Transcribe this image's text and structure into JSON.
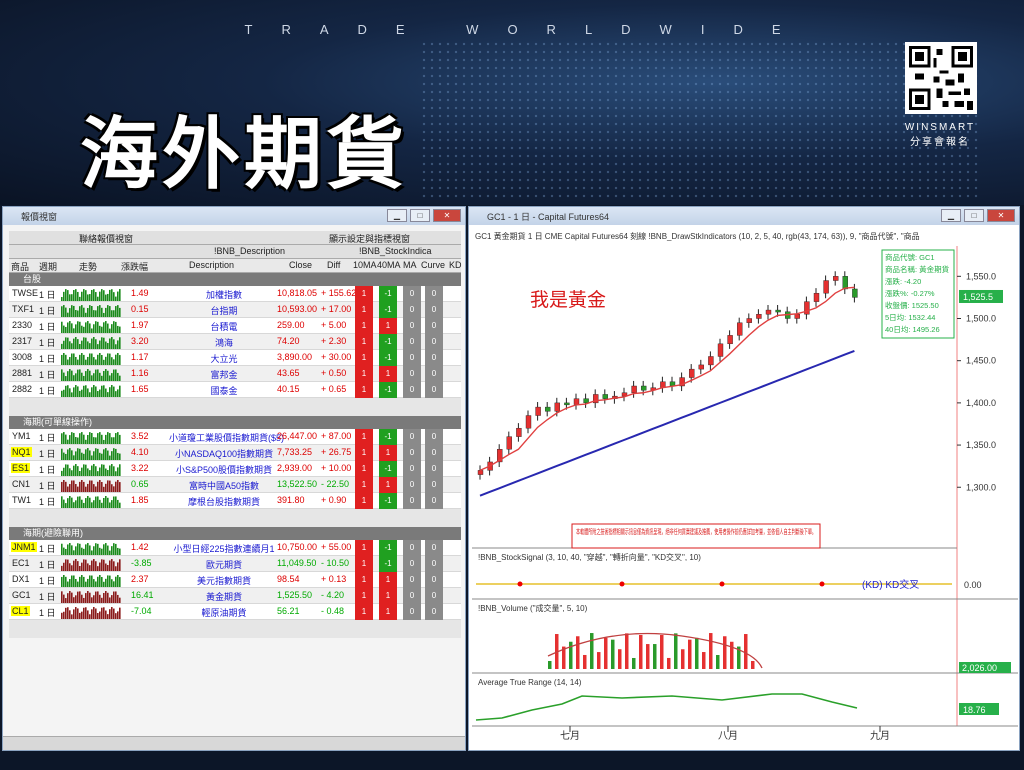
{
  "banner": {
    "tagline": "TRADE WORLDWIDE",
    "title": "海外期貨",
    "brand_line1": "WINSMART",
    "brand_line2": "分享會報名"
  },
  "left_window": {
    "title": "報價視窗",
    "col1_title": "聯絡報價視窗",
    "col2_title": "顯示設定與指標視窗",
    "desc_group": "!BNB_Description",
    "sig_group": "!BNB_StockIndica",
    "headers": {
      "symbol": "商品",
      "period": "週期",
      "trend": "走勢",
      "amp": "漲跌幅",
      "desc": "Description",
      "close": "Close",
      "diff": "Diff",
      "ma10": "10MA",
      "ma40": "40MA",
      "ma": "MA",
      "curve": "Curve",
      "kd": "KD"
    },
    "sections": [
      {
        "name": "台股",
        "rows": [
          {
            "sym": "TWSE",
            "per": "1 日",
            "amp": "1.49",
            "desc": "加權指數",
            "close": "10,818.05",
            "diff": "+ 155.62",
            "c1": "1",
            "c2": "-1",
            "c3": "0",
            "c4": "0",
            "hl": false,
            "up": true
          },
          {
            "sym": "TXF1",
            "per": "1 日",
            "amp": "0.15",
            "desc": "台指期",
            "close": "10,593.00",
            "diff": "+ 17.00",
            "c1": "1",
            "c2": "-1",
            "c3": "0",
            "c4": "0",
            "hl": false,
            "up": true
          },
          {
            "sym": "2330",
            "per": "1 日",
            "amp": "1.97",
            "desc": "台積電",
            "close": "259.00",
            "diff": "+ 5.00",
            "c1": "1",
            "c2": "1",
            "c3": "0",
            "c4": "0",
            "hl": false,
            "up": true
          },
          {
            "sym": "2317",
            "per": "1 日",
            "amp": "3.20",
            "desc": "鴻海",
            "close": "74.20",
            "diff": "+ 2.30",
            "c1": "1",
            "c2": "-1",
            "c3": "0",
            "c4": "0",
            "hl": false,
            "up": true
          },
          {
            "sym": "3008",
            "per": "1 日",
            "amp": "1.17",
            "desc": "大立光",
            "close": "3,890.00",
            "diff": "+ 30.00",
            "c1": "1",
            "c2": "-1",
            "c3": "0",
            "c4": "0",
            "hl": false,
            "up": true
          },
          {
            "sym": "2881",
            "per": "1 日",
            "amp": "1.16",
            "desc": "富邦金",
            "close": "43.65",
            "diff": "+ 0.50",
            "c1": "1",
            "c2": "1",
            "c3": "0",
            "c4": "0",
            "hl": false,
            "up": true
          },
          {
            "sym": "2882",
            "per": "1 日",
            "amp": "1.65",
            "desc": "國泰金",
            "close": "40.15",
            "diff": "+ 0.65",
            "c1": "1",
            "c2": "-1",
            "c3": "0",
            "c4": "0",
            "hl": false,
            "up": true
          }
        ]
      },
      {
        "name": "海期(可單線操作)",
        "rows": [
          {
            "sym": "YM1",
            "per": "1 日",
            "amp": "3.52",
            "desc": "小道瓊工業股價指數期貨($5)",
            "close": "26,447.00",
            "diff": "+ 87.00",
            "c1": "1",
            "c2": "-1",
            "c3": "0",
            "c4": "0",
            "hl": false,
            "up": true
          },
          {
            "sym": "NQ1",
            "per": "1 日",
            "amp": "4.10",
            "desc": "小NASDAQ100指數期貨",
            "close": "7,733.25",
            "diff": "+ 26.75",
            "c1": "1",
            "c2": "1",
            "c3": "0",
            "c4": "0",
            "hl": true,
            "up": true
          },
          {
            "sym": "ES1",
            "per": "1 日",
            "amp": "3.22",
            "desc": "小S&P500股價指數期貨",
            "close": "2,939.00",
            "diff": "+ 10.00",
            "c1": "1",
            "c2": "-1",
            "c3": "0",
            "c4": "0",
            "hl": true,
            "up": true
          },
          {
            "sym": "CN1",
            "per": "1 日",
            "amp": "0.65",
            "desc": "富時中國A50指數",
            "close": "13,522.50",
            "diff": "- 22.50",
            "c1": "1",
            "c2": "1",
            "c3": "0",
            "c4": "0",
            "hl": false,
            "up": false
          },
          {
            "sym": "TW1",
            "per": "1 日",
            "amp": "1.85",
            "desc": "摩根台股指數期貨",
            "close": "391.80",
            "diff": "+ 0.90",
            "c1": "1",
            "c2": "-1",
            "c3": "0",
            "c4": "0",
            "hl": false,
            "up": true
          }
        ]
      },
      {
        "name": "海期(避險聯用)",
        "rows": [
          {
            "sym": "JNM1",
            "per": "1 日",
            "amp": "1.42",
            "desc": "小型日經225指數連續月1",
            "close": "10,750.00",
            "diff": "+ 55.00",
            "c1": "1",
            "c2": "-1",
            "c3": "0",
            "c4": "0",
            "hl": true,
            "up": true
          },
          {
            "sym": "EC1",
            "per": "1 日",
            "amp": "-3.85",
            "desc": "歐元期貨",
            "close": "11,049.50",
            "diff": "- 10.50",
            "c1": "1",
            "c2": "-1",
            "c3": "0",
            "c4": "0",
            "hl": false,
            "up": false
          },
          {
            "sym": "DX1",
            "per": "1 日",
            "amp": "2.37",
            "desc": "美元指數期貨",
            "close": "98.54",
            "diff": "+ 0.13",
            "c1": "1",
            "c2": "1",
            "c3": "0",
            "c4": "0",
            "hl": false,
            "up": true
          },
          {
            "sym": "GC1",
            "per": "1 日",
            "amp": "16.41",
            "desc": "黃金期貨",
            "close": "1,525.50",
            "diff": "- 4.20",
            "c1": "1",
            "c2": "1",
            "c3": "0",
            "c4": "0",
            "hl": false,
            "up": false
          },
          {
            "sym": "CL1",
            "per": "1 日",
            "amp": "-7.04",
            "desc": "輕原油期貨",
            "close": "56.21",
            "diff": "- 0.48",
            "c1": "1",
            "c2": "1",
            "c3": "0",
            "c4": "0",
            "hl": true,
            "up": false
          }
        ]
      }
    ]
  },
  "right_window": {
    "title": "GC1 - 1 日 - Capital Futures64",
    "toolbar": "GC1 黃金期貨 1 日 CME Capital Futures64 刻線 !BNB_DrawStkIndicators (10, 2, 5, 40, rgb(43, 174, 63)), 9, \"商品代號\", \"商品",
    "annotation": "我是黃金",
    "disclaimer": "本軟體所附之技術指標相關示訊息僅為資訊呈現，絕非任何買賣建議及推薦，使用者操作前仍應詳加考量，並依個人自主判斷後下單。",
    "info_box": [
      "商品代號: GC1",
      "商品名稱: 黃金期貨",
      "漲跌: -4.20",
      "漲跌%: -0.27%",
      "收盤價: 1525.50",
      "5日均: 1532.44",
      "40日均: 1495.26"
    ],
    "price_ticks": [
      "1,550.0",
      "1,500.0",
      "1,450.0",
      "1,400.0",
      "1,350.0",
      "1,300.0"
    ],
    "price_tag": "1,525.5",
    "signal_label": "!BNB_StockSignal   (3, 10, 40, \"穿越\", \"轉折向量\", \"KD交叉\", 10)",
    "signal_tick": "0.00",
    "signal_legend": "(KD) KD交叉",
    "volume_label": "!BNB_Volume   (\"成交量\", 5, 10)",
    "volume_tag": "2,026.00",
    "atr_label": "Average True Range   (14, 14)",
    "atr_tag": "18.76",
    "months": [
      "七月",
      "八月",
      "九月"
    ]
  },
  "chart_data": {
    "type": "line",
    "title": "",
    "series": [
      {
        "name": "GC1",
        "values": [
          1320,
          1330,
          1345,
          1360,
          1370,
          1385,
          1395,
          1390,
          1400,
          1398,
          1405,
          1400,
          1410,
          1405,
          1408,
          1412,
          1420,
          1415,
          1418,
          1425,
          1420,
          1430,
          1440,
          1445,
          1455,
          1470,
          1480,
          1495,
          1500,
          1505,
          1510,
          1508,
          1500,
          1505,
          1520,
          1530,
          1545,
          1550,
          1535,
          1525
        ]
      }
    ],
    "ylim": [
      1260,
      1580
    ]
  }
}
